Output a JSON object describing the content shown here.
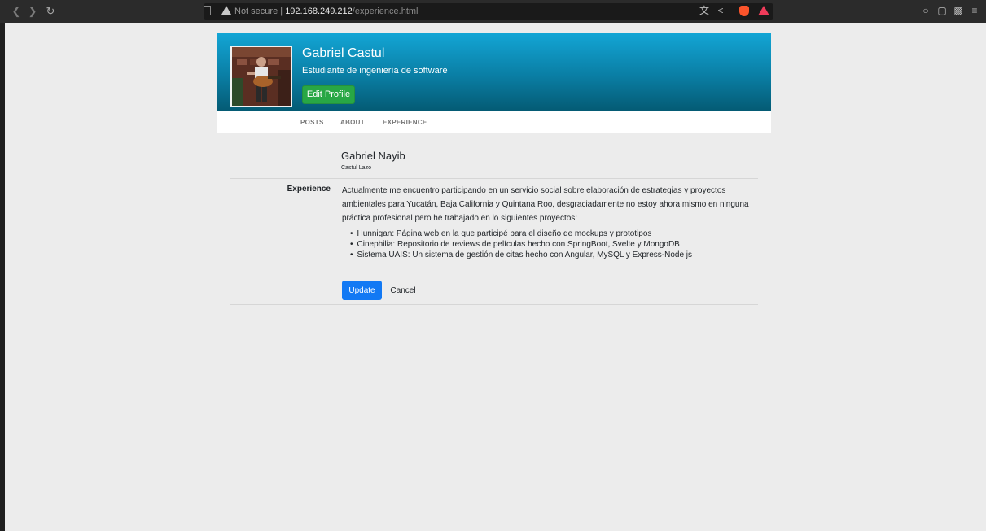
{
  "browser": {
    "security_label": "Not secure",
    "url_host": "192.168.249.212",
    "url_path": "/experience.html"
  },
  "profile": {
    "name": "Gabriel Castul",
    "tagline": "Estudiante de ingeniería de software",
    "edit_label": "Edit Profile"
  },
  "tabs": [
    {
      "label": "POSTS"
    },
    {
      "label": "ABOUT"
    },
    {
      "label": "EXPERIENCE"
    }
  ],
  "content": {
    "first_name": "Gabriel Nayib",
    "last_name": "Castul Lazo",
    "section_label": "Experience",
    "description": "Actualmente me encuentro participando en un servicio social sobre elaboración de estrategias y proyectos ambientales para Yucatán, Baja California y Quintana Roo, desgraciadamente no estoy ahora mismo en ninguna práctica profesional pero he trabajado en lo siguientes proyectos:",
    "projects": [
      "Hunnigan: Página web en la que participé para el diseño de mockups y prototipos",
      "Cinephilia: Repositorio de reviews de películas hecho con SpringBoot, Svelte y MongoDB",
      "Sistema UAIS: Un sistema de gestión de citas hecho con Angular, MySQL y Express-Node js"
    ]
  },
  "actions": {
    "update_label": "Update",
    "cancel_label": "Cancel"
  },
  "colors": {
    "hero_top": "#13a6d6",
    "hero_bottom": "#045a73",
    "edit_button": "#28a745",
    "update_button": "#1279f4"
  }
}
